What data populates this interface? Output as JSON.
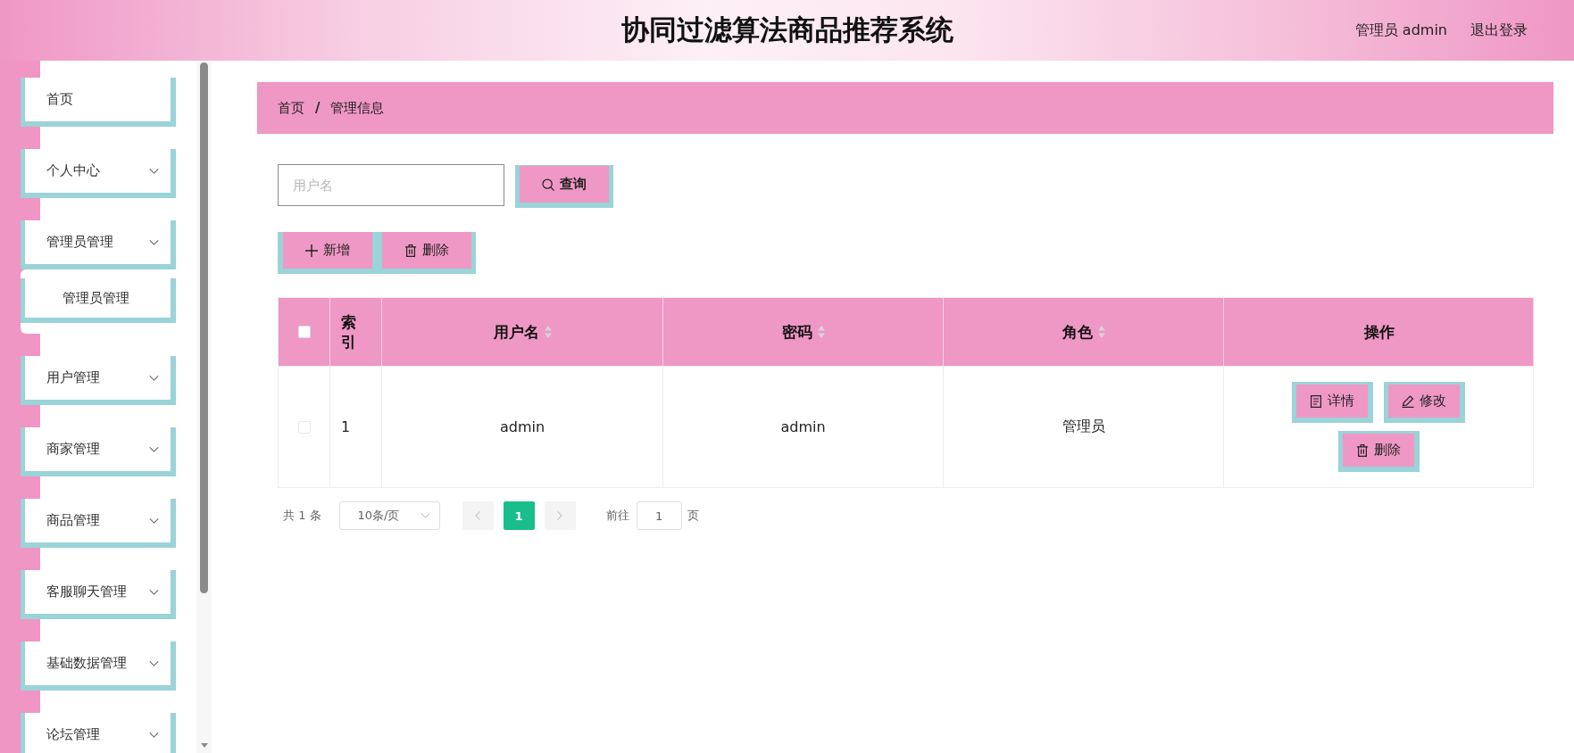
{
  "header": {
    "title": "协同过滤算法商品推荐系统",
    "user": "管理员 admin",
    "logout": "退出登录"
  },
  "sidebar": {
    "items": [
      {
        "label": "首页",
        "kind": "link"
      },
      {
        "label": "个人中心",
        "kind": "menu"
      },
      {
        "label": "管理员管理",
        "kind": "menu",
        "children": [
          {
            "label": "管理员管理"
          }
        ]
      },
      {
        "label": "用户管理",
        "kind": "menu"
      },
      {
        "label": "商家管理",
        "kind": "menu"
      },
      {
        "label": "商品管理",
        "kind": "menu"
      },
      {
        "label": "客服聊天管理",
        "kind": "menu"
      },
      {
        "label": "基础数据管理",
        "kind": "menu"
      },
      {
        "label": "论坛管理",
        "kind": "menu"
      }
    ]
  },
  "breadcrumb": {
    "items": [
      "首页",
      "管理信息"
    ],
    "separator": "/"
  },
  "search": {
    "placeholder": "用户名",
    "button": "查询"
  },
  "toolbar": [
    {
      "label": "新增",
      "kind": "add"
    },
    {
      "label": "删除",
      "kind": "delete"
    }
  ],
  "table": {
    "select_all_checked": false,
    "columns": [
      {
        "label": "索引",
        "sortable": false
      },
      {
        "label": "用户名",
        "sortable": true
      },
      {
        "label": "密码",
        "sortable": true
      },
      {
        "label": "角色",
        "sortable": true
      },
      {
        "label": "操作",
        "sortable": false
      }
    ],
    "rows": [
      {
        "checked": false,
        "cells": [
          "1",
          "admin",
          "admin",
          "管理员"
        ],
        "actions": [
          {
            "label": "详情",
            "kind": "detail"
          },
          {
            "label": "修改",
            "kind": "edit"
          },
          {
            "label": "删除",
            "kind": "delete"
          }
        ]
      }
    ]
  },
  "pagination": {
    "total": "共 1 条",
    "page_size": "10条/页",
    "prev_disabled": true,
    "pages": [
      {
        "label": "1",
        "selected": true
      }
    ],
    "next_disabled": true,
    "goto_label": "前往",
    "goto_value": "1",
    "goto_suffix": "页"
  }
}
